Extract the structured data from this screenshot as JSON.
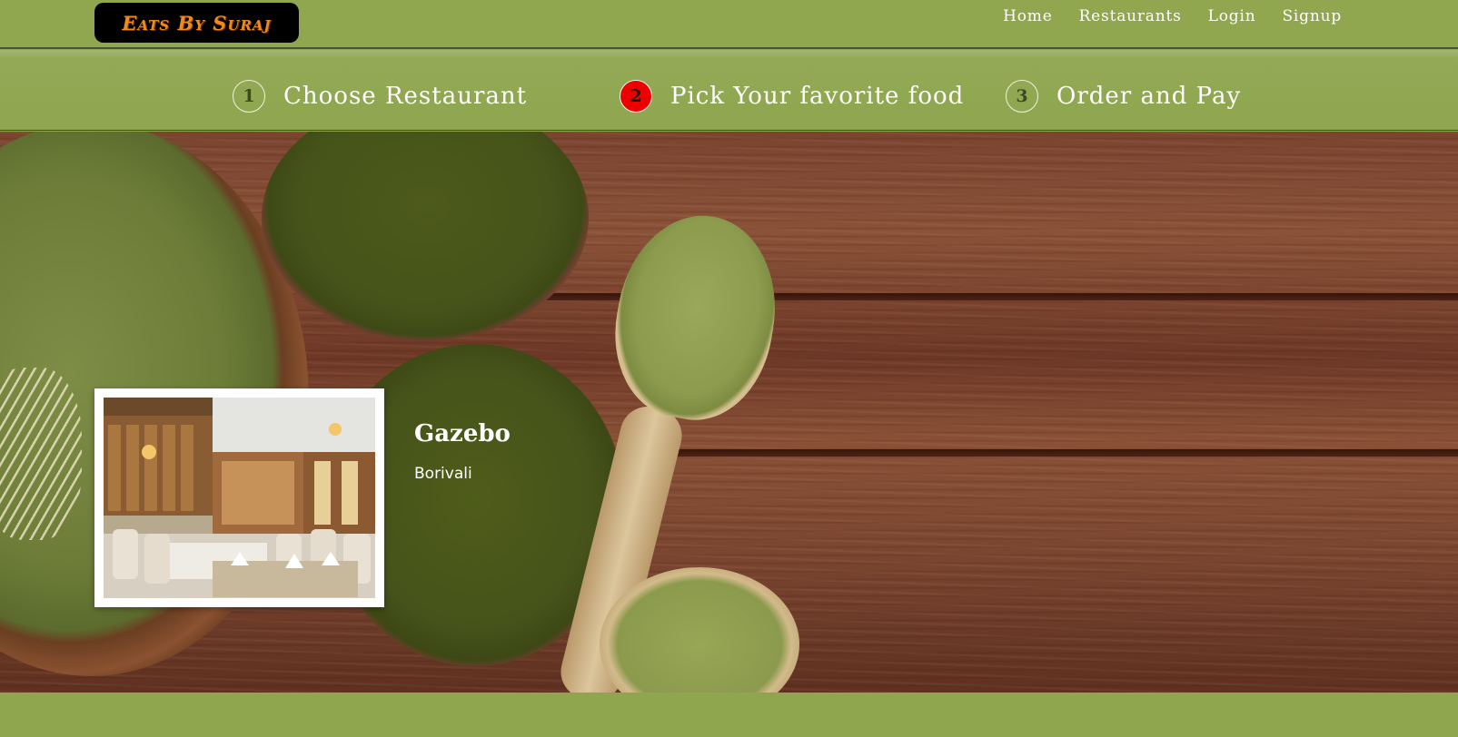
{
  "brand": {
    "name": "Eats By Suraj"
  },
  "nav": {
    "links": [
      {
        "label": "Home"
      },
      {
        "label": "Restaurants"
      },
      {
        "label": "Login"
      },
      {
        "label": "Signup"
      }
    ]
  },
  "steps": [
    {
      "number": "1",
      "label": "Choose Restaurant",
      "active": false
    },
    {
      "number": "2",
      "label": "Pick Your favorite food",
      "active": true
    },
    {
      "number": "3",
      "label": "Order and Pay",
      "active": false
    }
  ],
  "restaurant": {
    "name": "Gazebo",
    "location": "Borivali",
    "image": "restaurant-interior-photo"
  },
  "colors": {
    "nav_bg": "#90a74f",
    "brand_bg": "#000000",
    "brand_text": "#f08a1c",
    "active_step": "#ee0000"
  }
}
